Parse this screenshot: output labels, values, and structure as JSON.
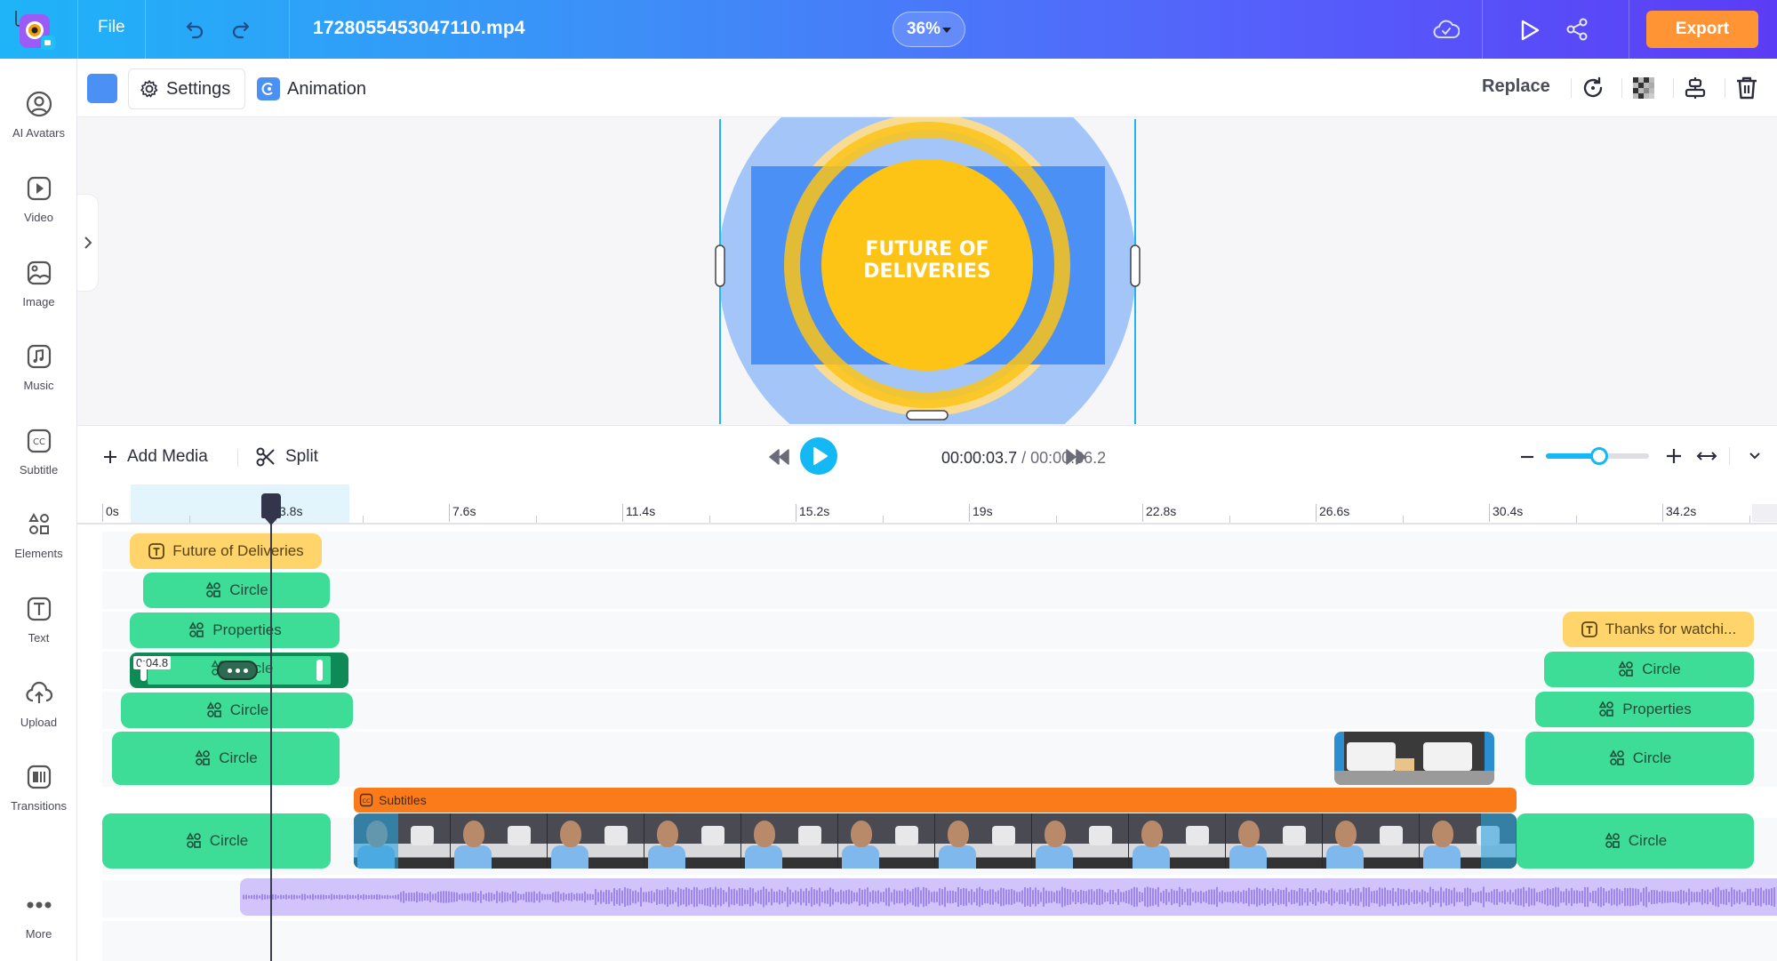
{
  "topbar": {
    "file_label": "File",
    "filename": "1728055453047110.mp4",
    "zoom_level": "36%",
    "export_label": "Export",
    "icons": [
      "app-logo",
      "undo-icon",
      "redo-icon",
      "cloud-saved-icon",
      "preview-play-icon",
      "share-icon"
    ]
  },
  "sidebar": {
    "items": [
      {
        "label": "AI Avatars",
        "icon": "avatar-icon"
      },
      {
        "label": "Video",
        "icon": "video-icon"
      },
      {
        "label": "Image",
        "icon": "image-icon"
      },
      {
        "label": "Music",
        "icon": "music-icon"
      },
      {
        "label": "Subtitle",
        "icon": "subtitle-icon"
      },
      {
        "label": "Elements",
        "icon": "elements-icon"
      },
      {
        "label": "Text",
        "icon": "text-icon"
      },
      {
        "label": "Upload",
        "icon": "upload-icon"
      },
      {
        "label": "Transitions",
        "icon": "transitions-icon"
      },
      {
        "label": "More",
        "icon": "more-icon"
      }
    ]
  },
  "toolbar": {
    "color_value": "#4b90f5",
    "settings_label": "Settings",
    "animation_label": "Animation",
    "replace_label": "Replace"
  },
  "canvas": {
    "headline_line1": "FUTURE OF",
    "headline_line2": "DELIVERIES",
    "colors": {
      "blue": "#4b90f5",
      "light_blue": "#a4c5f8",
      "yellow": "#fdc315",
      "light_yellow": "#f9dc93"
    }
  },
  "timeline": {
    "add_media_label": "Add Media",
    "split_label": "Split",
    "current_time": "00:00:03.7",
    "separator": " / ",
    "total_time": "00:00:36.2",
    "zoom_slider_fraction": 0.52,
    "ruler_ticks": [
      "0s",
      "3.8s",
      "7.6s",
      "11.4s",
      "15.2s",
      "19s",
      "22.8s",
      "26.6s",
      "30.4s",
      "34.2s"
    ],
    "selected_clip_duration": "0:04.8",
    "clips": {
      "title_text": "Future of Deliveries",
      "end_text": "Thanks for watchi...",
      "circle": "Circle",
      "properties": "Properties",
      "subtitles": "Subtitles"
    }
  }
}
